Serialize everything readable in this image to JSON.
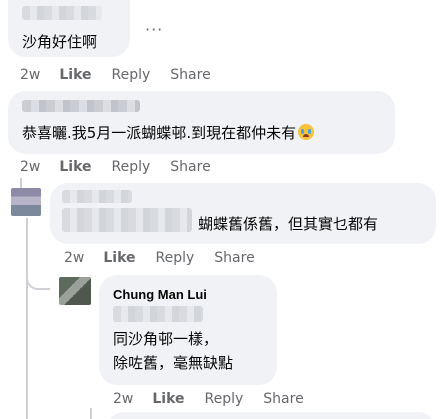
{
  "comments": [
    {
      "text": "沙角好住啊",
      "meta": {
        "time": "2w",
        "like": "Like",
        "reply": "Reply",
        "share": "Share"
      }
    },
    {
      "text": "恭喜曬.我5月一派蝴蝶邨.到現在都仲未有",
      "emoji": "crying-face",
      "meta": {
        "time": "2w",
        "like": "Like",
        "reply": "Reply",
        "share": "Share"
      }
    },
    {
      "text": "蝴蝶舊係舊，但其實乜都有",
      "meta": {
        "time": "2w",
        "like": "Like",
        "reply": "Reply",
        "share": "Share"
      }
    },
    {
      "author": "Chung Man Lui",
      "line1": "同沙角邨一樣，",
      "line2": "除咗舊，毫無缺點",
      "meta": {
        "time": "2w",
        "like": "Like",
        "reply": "Reply",
        "share": "Share"
      }
    }
  ],
  "more_icon": "ellipsis-icon",
  "colors": {
    "bubble": "#f0f2f5",
    "meta": "#65676b",
    "text": "#050505"
  }
}
